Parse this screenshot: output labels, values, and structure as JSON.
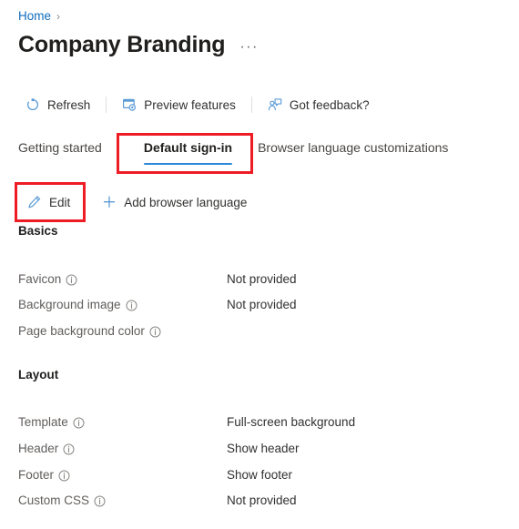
{
  "breadcrumb": {
    "home_label": "Home",
    "separator": "›"
  },
  "header": {
    "title": "Company Branding",
    "more_label": "···"
  },
  "command_bar": {
    "items": [
      {
        "label": "Refresh",
        "icon": "refresh-icon"
      },
      {
        "label": "Preview features",
        "icon": "preview-features-icon"
      },
      {
        "label": "Got feedback?",
        "icon": "feedback-icon"
      }
    ]
  },
  "tabs": [
    {
      "label": "Getting started",
      "selected": false
    },
    {
      "label": "Default sign-in",
      "selected": true
    },
    {
      "label": "Browser language customizations",
      "selected": false
    }
  ],
  "sub_command_bar": {
    "items": [
      {
        "label": "Edit",
        "icon": "pencil-icon"
      },
      {
        "label": "Add browser language",
        "icon": "plus-icon"
      }
    ]
  },
  "sections": [
    {
      "heading": "Basics",
      "rows": [
        {
          "label": "Favicon",
          "info": "info-icon",
          "value": "Not provided"
        },
        {
          "label": "Background image",
          "info": "info-icon",
          "value": "Not provided"
        },
        {
          "label": "Page background color",
          "info": "info-icon",
          "value": ""
        }
      ]
    },
    {
      "heading": "Layout",
      "rows": [
        {
          "label": "Template",
          "info": "info-icon",
          "value": "Full-screen background"
        },
        {
          "label": "Header",
          "info": "info-icon",
          "value": "Show header"
        },
        {
          "label": "Footer",
          "info": "info-icon",
          "value": "Show footer"
        },
        {
          "label": "Custom CSS",
          "info": "info-icon",
          "value": "Not provided"
        }
      ]
    }
  ],
  "annotations": [
    {
      "name": "default-signin-highlight",
      "color": "#ee1c25"
    },
    {
      "name": "edit-highlight",
      "color": "#ee1c25"
    }
  ],
  "colors": {
    "link": "#0f6cbd",
    "tab_underline": "#2b88d8",
    "icon_blue": "#5b9bd5",
    "annotation_red": "#ee1c25",
    "label_gray": "#605e5c",
    "text_dark": "#201f1e"
  }
}
